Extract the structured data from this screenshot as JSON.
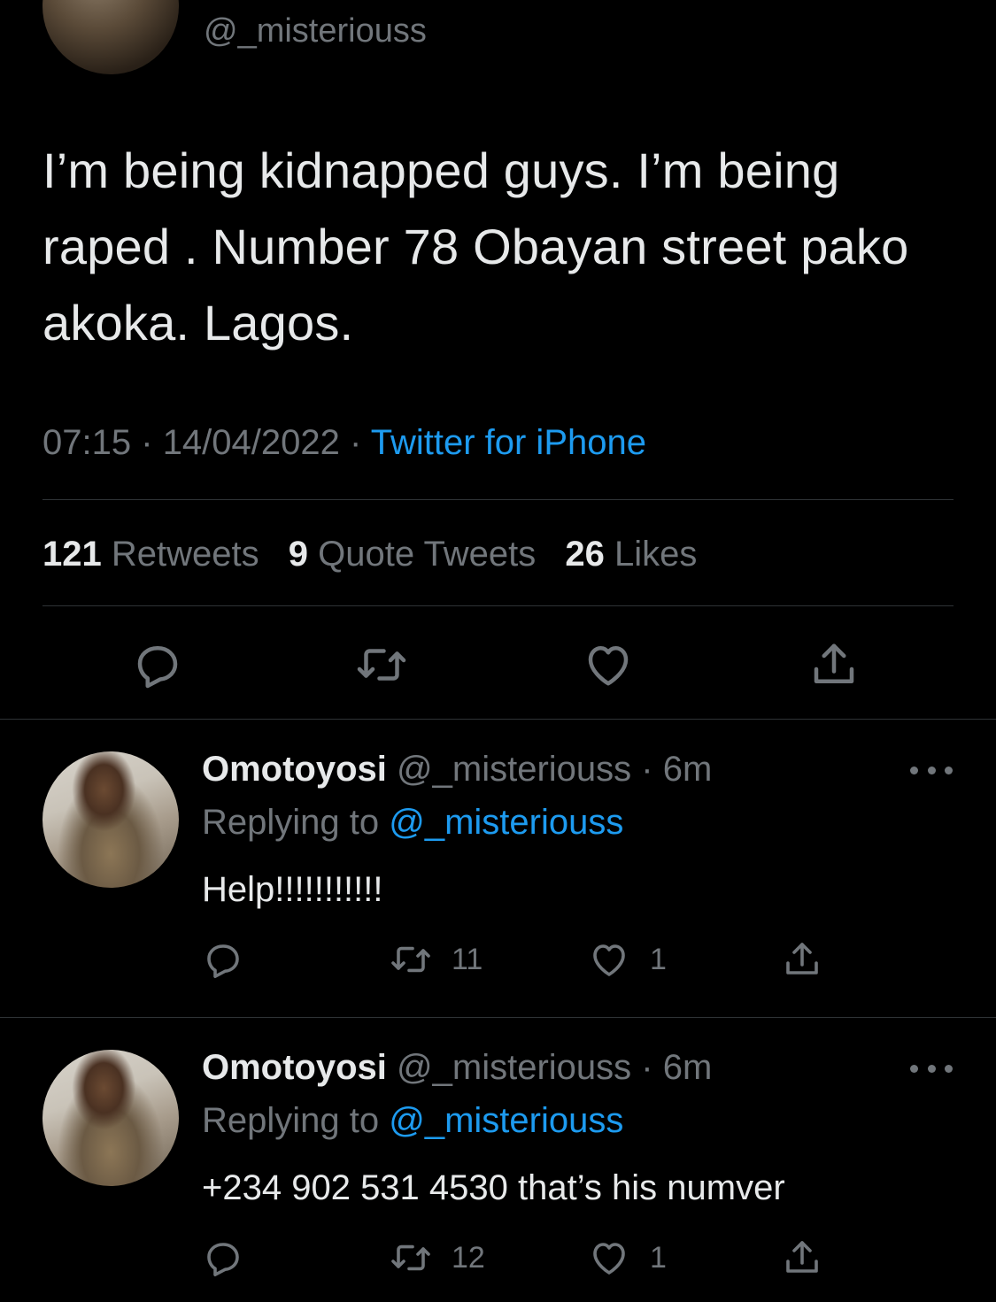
{
  "main_tweet": {
    "handle": "@_misteriouss",
    "text": "I’m being kidnapped guys. I’m being raped . Number 78 Obayan street pako akoka. Lagos.",
    "time": "07:15",
    "date": "14/04/2022",
    "separator": "·",
    "source": "Twitter for iPhone",
    "stats": {
      "retweets_count": "121",
      "retweets_label": "Retweets",
      "quotes_count": "9",
      "quotes_label": "Quote Tweets",
      "likes_count": "26",
      "likes_label": "Likes"
    },
    "actions": [
      "reply-icon",
      "retweet-icon",
      "like-icon",
      "share-icon"
    ]
  },
  "replies": [
    {
      "name": "Omotoyosi",
      "handle": "@_misteriouss",
      "time": "6m",
      "replying_label": "Replying to",
      "replying_to": "@_misteriouss",
      "text": "Help!!!!!!!!!!!",
      "retweets": "11",
      "likes": "1"
    },
    {
      "name": "Omotoyosi",
      "handle": "@_misteriouss",
      "time": "6m",
      "replying_label": "Replying to",
      "replying_to": "@_misteriouss",
      "text": "+234 902 531 4530 that’s his numver",
      "retweets": "12",
      "likes": "1"
    }
  ],
  "colors": {
    "background": "#000000",
    "text": "#e7e9ea",
    "muted": "#71767b",
    "link": "#1d9bf0",
    "divider": "#2f3336"
  }
}
